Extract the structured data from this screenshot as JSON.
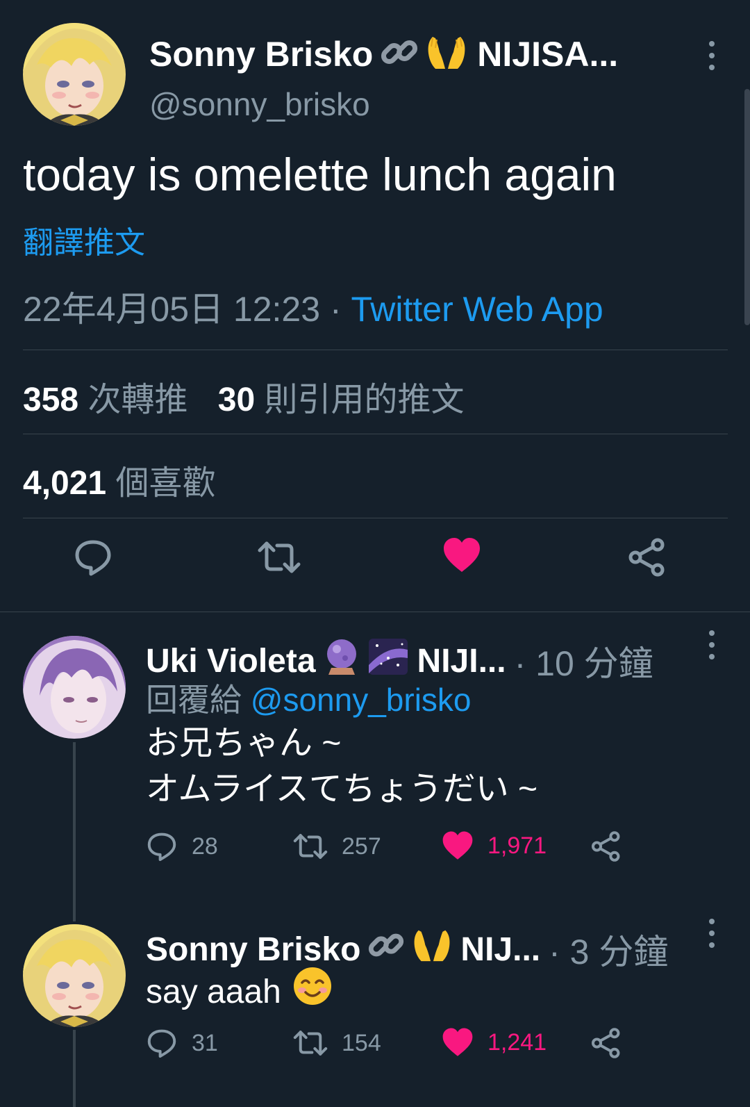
{
  "main_tweet": {
    "display_name": "Sonny Brisko",
    "name_suffix": "NIJISA...",
    "handle": "@sonny_brisko",
    "text": "today is omelette lunch again",
    "translate_label": "翻譯推文",
    "timestamp": "22年4月05日 12:23",
    "separator": " · ",
    "source": "Twitter Web App",
    "retweets_count": "358",
    "retweets_label": "次轉推",
    "quotes_count": "30",
    "quotes_label": "則引用的推文",
    "likes_count": "4,021",
    "likes_label": "個喜歡",
    "liked": true
  },
  "replies": [
    {
      "display_name": "Uki Violeta",
      "name_suffix": "NIJI...",
      "time": "· 10 分鐘",
      "reply_to_label": "回覆給",
      "reply_to_handle": "@sonny_brisko",
      "text_line1": "お兄ちゃん ~",
      "text_line2": "オムライスてちょうだい ~",
      "replies": "28",
      "retweets": "257",
      "likes": "1,971",
      "liked": true
    },
    {
      "display_name": "Sonny Brisko",
      "name_suffix": "NIJ...",
      "time": "· 3 分鐘",
      "text_line1": "say aaah",
      "replies": "31",
      "retweets": "154",
      "likes": "1,241",
      "liked": true
    }
  ],
  "colors": {
    "background": "#15202b",
    "accent_blue": "#1d9bf0",
    "like_pink": "#f91880",
    "secondary_text": "#8899a6",
    "divider": "#38444d"
  },
  "icons": [
    "reply-icon",
    "retweet-icon",
    "like-icon",
    "share-icon",
    "more-icon",
    "link-icon",
    "raised-hands-icon",
    "crystal-ball-icon",
    "milky-way-icon",
    "smiling-face-icon"
  ]
}
